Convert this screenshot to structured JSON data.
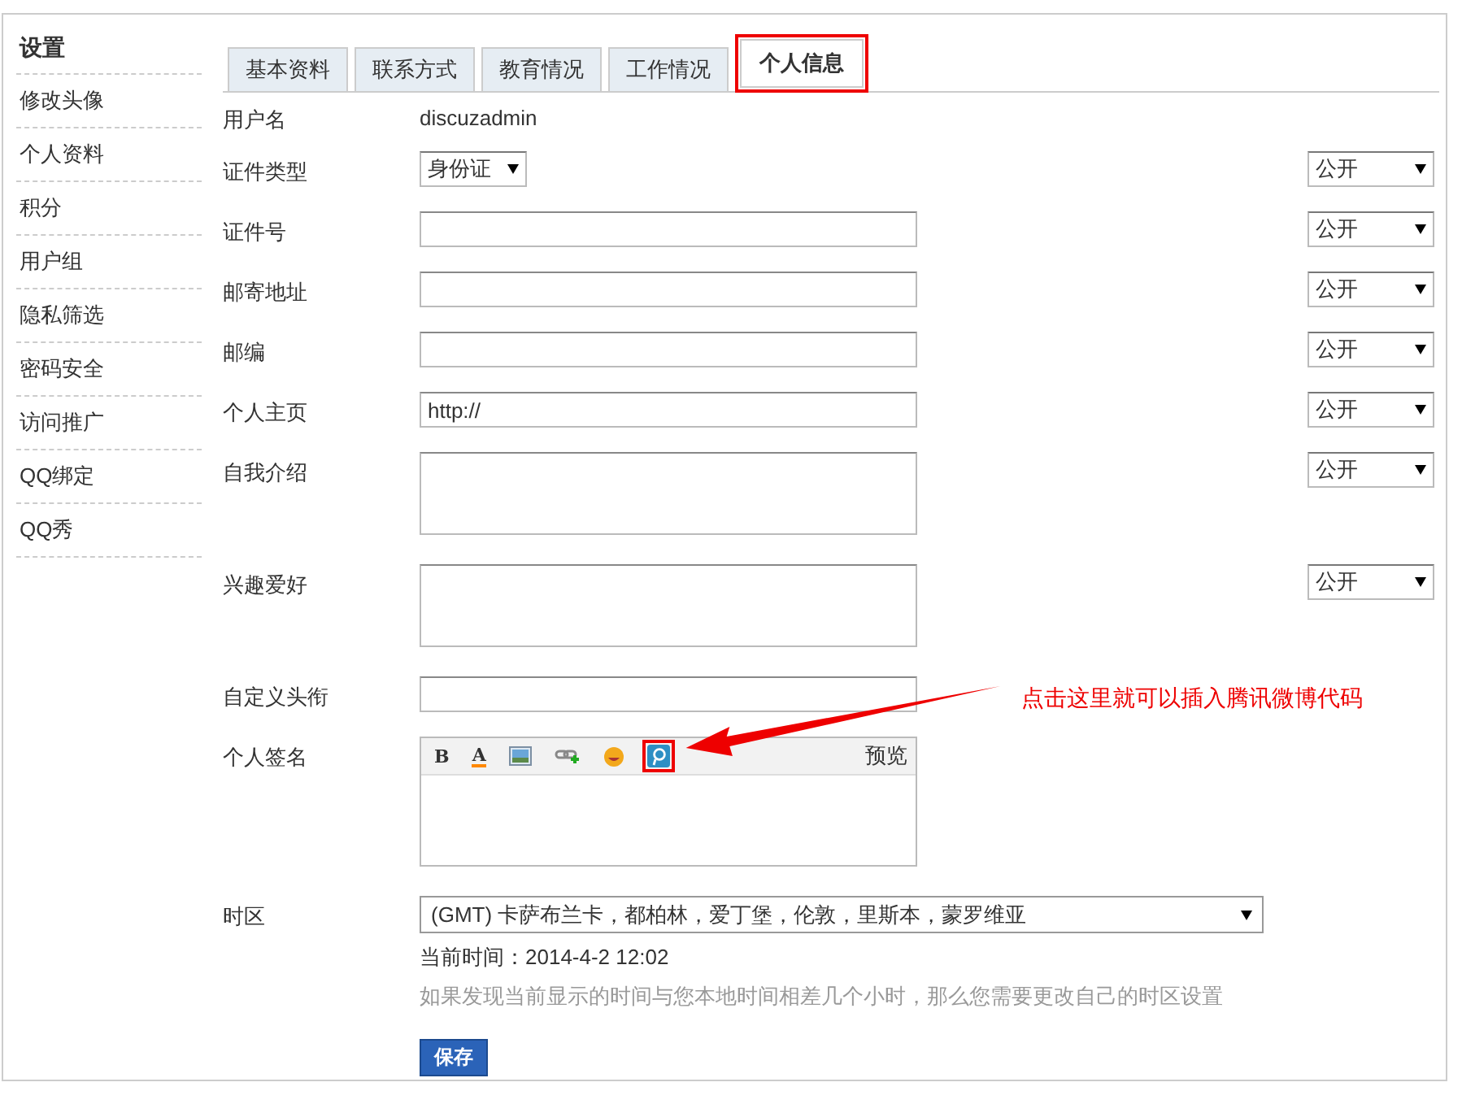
{
  "sidebar": {
    "title": "设置",
    "items": [
      "修改头像",
      "个人资料",
      "积分",
      "用户组",
      "隐私筛选",
      "密码安全",
      "访问推广",
      "QQ绑定",
      "QQ秀"
    ]
  },
  "tabs": [
    {
      "label": "基本资料",
      "selected": false,
      "highlighted": false
    },
    {
      "label": "联系方式",
      "selected": false,
      "highlighted": false
    },
    {
      "label": "教育情况",
      "selected": false,
      "highlighted": false
    },
    {
      "label": "工作情况",
      "selected": false,
      "highlighted": false
    },
    {
      "label": "个人信息",
      "selected": true,
      "highlighted": true
    }
  ],
  "fields": [
    {
      "kind": "text",
      "label": "用户名",
      "value": "discuzadmin"
    },
    {
      "kind": "select",
      "label": "证件类型",
      "value": "身份证",
      "privacy": "公开"
    },
    {
      "kind": "input",
      "label": "证件号",
      "privacy": "公开"
    },
    {
      "kind": "input",
      "label": "邮寄地址",
      "privacy": "公开"
    },
    {
      "kind": "input",
      "label": "邮编",
      "privacy": "公开"
    },
    {
      "kind": "input",
      "label": "个人主页",
      "value": "http://",
      "privacy": "公开"
    },
    {
      "kind": "textarea",
      "label": "自我介绍",
      "privacy": "公开"
    },
    {
      "kind": "textarea",
      "label": "兴趣爱好",
      "privacy": "公开"
    },
    {
      "kind": "input",
      "label": "自定义头衔"
    },
    {
      "kind": "editor",
      "label": "个人签名",
      "preview": "预览",
      "tools": [
        {
          "kind": "bold",
          "glyph": "B",
          "highlighted": false
        },
        {
          "kind": "color",
          "glyph": "A",
          "highlighted": false
        },
        {
          "kind": "image",
          "highlighted": false
        },
        {
          "kind": "link",
          "highlighted": false
        },
        {
          "kind": "emoji",
          "highlighted": false
        },
        {
          "kind": "weibo",
          "highlighted": true
        }
      ]
    },
    {
      "kind": "timezone",
      "label": "时区",
      "value": "(GMT) 卡萨布兰卡，都柏林，爱丁堡，伦敦，里斯本，蒙罗维亚",
      "current_time": "当前时间：2014-4-2 12:02",
      "hint": "如果发现当前显示的时间与您本地时间相差几个小时，那么您需要更改自己的时区设置"
    }
  ],
  "save_button": "保存",
  "annotation": {
    "text": "点击这里就可以插入腾讯微博代码"
  }
}
